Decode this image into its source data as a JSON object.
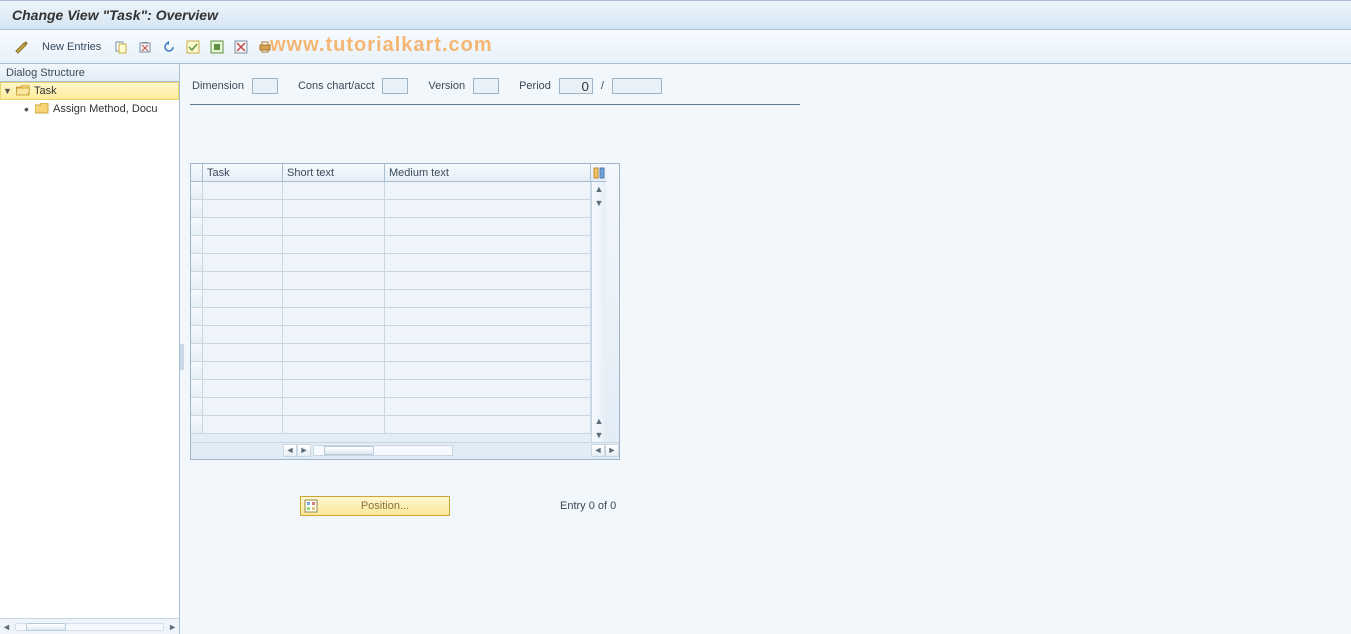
{
  "title": "Change View \"Task\": Overview",
  "toolbar": {
    "new_entries_label": "New Entries"
  },
  "watermark": "www.tutorialkart.com",
  "tree": {
    "header": "Dialog Structure",
    "root": {
      "label": "Task",
      "selected": true
    },
    "child": {
      "label": "Assign Method, Docu"
    }
  },
  "params": {
    "dimension_label": "Dimension",
    "conschart_label": "Cons chart/acct",
    "version_label": "Version",
    "period_label": "Period",
    "period_value": "0",
    "period_sep": "/"
  },
  "table": {
    "col_task": "Task",
    "col_short": "Short text",
    "col_medium": "Medium text"
  },
  "footer": {
    "position_label": "Position...",
    "entry_text": "Entry 0 of 0"
  }
}
